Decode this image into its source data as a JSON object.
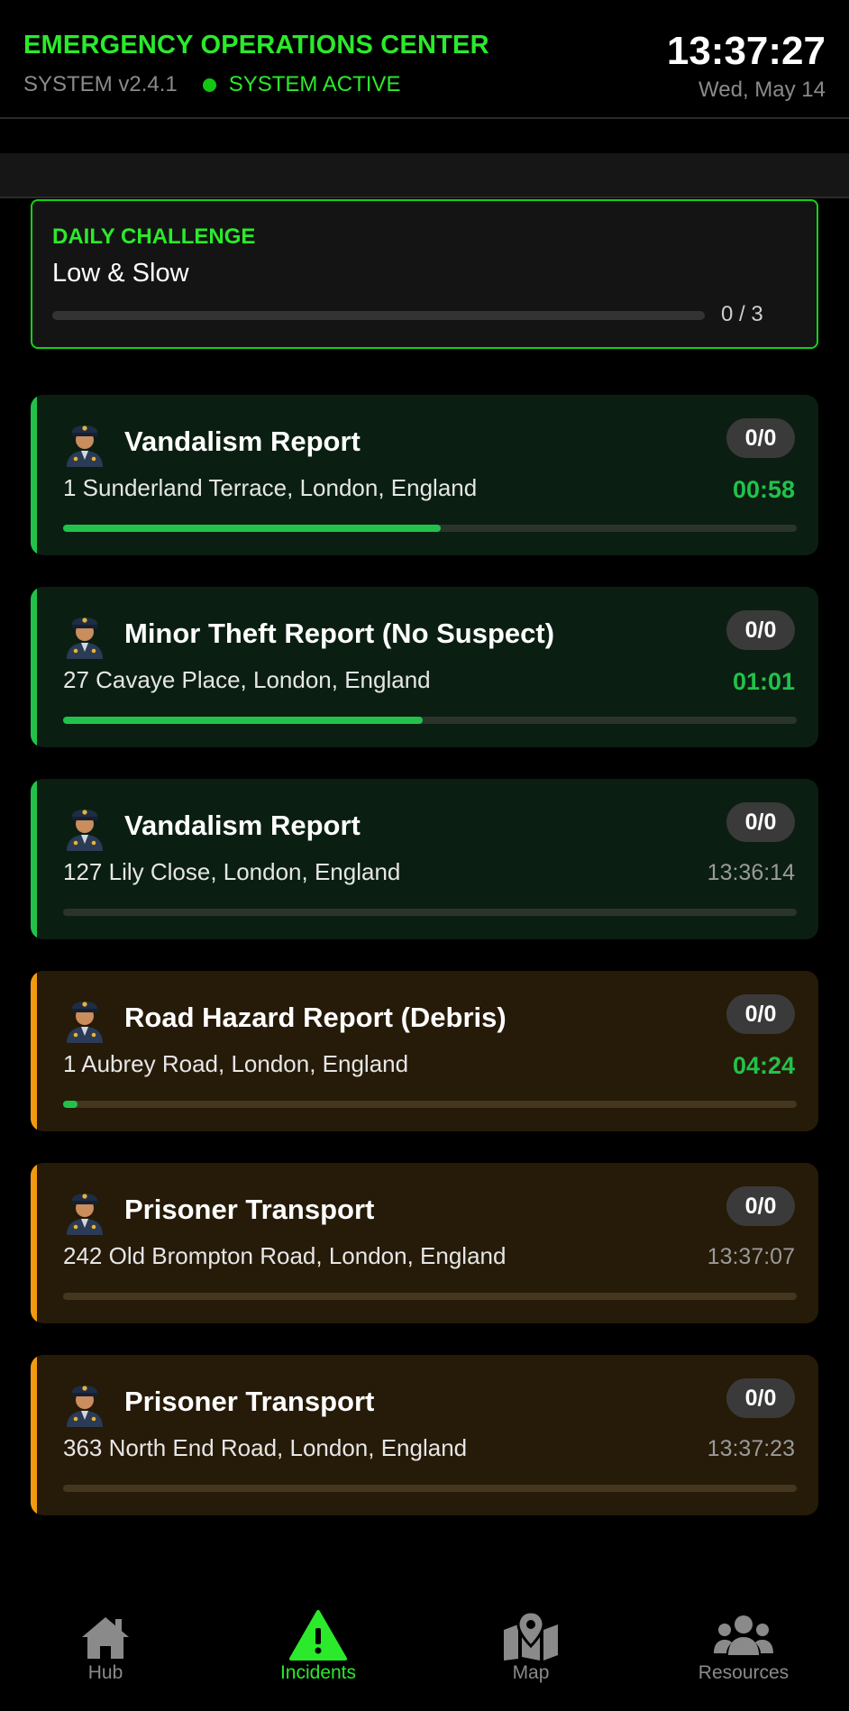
{
  "header": {
    "title": "EMERGENCY OPERATIONS CENTER",
    "version": "SYSTEM v2.4.1",
    "status": "SYSTEM ACTIVE",
    "time": "13:37:27",
    "date": "Wed, May 14"
  },
  "challenge": {
    "label": "DAILY CHALLENGE",
    "name": "Low & Slow",
    "progress_text": "0 / 3",
    "progress": 0
  },
  "incidents": [
    {
      "name": "Vandalism Report",
      "address": "1 Sunderland Terrace, London, England",
      "units": "0/0",
      "time": "00:58",
      "time_kind": "timer",
      "progress": 0.515,
      "tone": "green",
      "icon": "police-officer-icon"
    },
    {
      "name": "Minor Theft Report (No Suspect)",
      "address": "27 Cavaye Place, London, England",
      "units": "0/0",
      "time": "01:01",
      "time_kind": "timer",
      "progress": 0.49,
      "tone": "green",
      "icon": "police-officer-icon"
    },
    {
      "name": "Vandalism Report",
      "address": "127 Lily Close, London, England",
      "units": "0/0",
      "time": "13:36:14",
      "time_kind": "stamp",
      "progress": 0,
      "tone": "green",
      "icon": "police-officer-icon"
    },
    {
      "name": "Road Hazard Report (Debris)",
      "address": "1 Aubrey Road, London, England",
      "units": "0/0",
      "time": "04:24",
      "time_kind": "timer",
      "progress": 0.02,
      "tone": "orange",
      "icon": "police-officer-icon"
    },
    {
      "name": "Prisoner Transport",
      "address": "242 Old Brompton Road, London, England",
      "units": "0/0",
      "time": "13:37:07",
      "time_kind": "stamp",
      "progress": 0,
      "tone": "orange",
      "icon": "police-officer-icon"
    },
    {
      "name": "Prisoner Transport",
      "address": "363 North End Road, London, England",
      "units": "0/0",
      "time": "13:37:23",
      "time_kind": "stamp",
      "progress": 0,
      "tone": "orange",
      "icon": "police-officer-icon"
    }
  ],
  "nav": [
    {
      "label": "Hub",
      "icon": "home-icon",
      "active": false
    },
    {
      "label": "Incidents",
      "icon": "warning-icon",
      "active": true
    },
    {
      "label": "Map",
      "icon": "map-pin-icon",
      "active": false
    },
    {
      "label": "Resources",
      "icon": "users-icon",
      "active": false
    }
  ],
  "colors": {
    "accent": "#2bea2b",
    "green_edge": "#22c24a",
    "orange_edge": "#f29a0f"
  }
}
